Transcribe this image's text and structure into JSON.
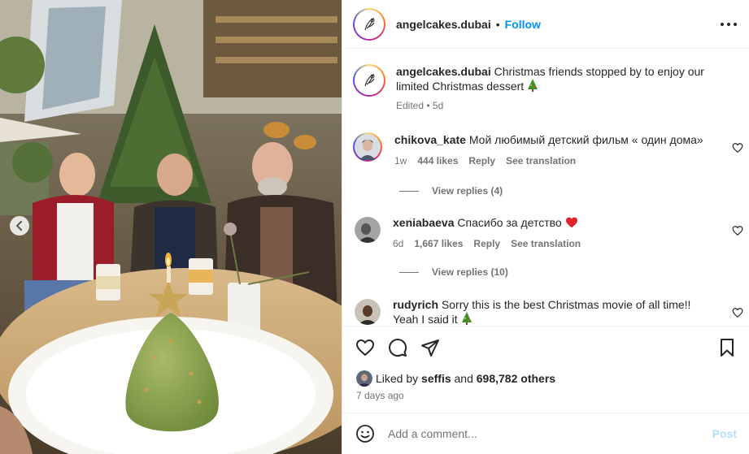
{
  "post": {
    "username": "angelcakes.dubai",
    "follow_label": "Follow",
    "separator": "•",
    "more_icon": "more-horizontal-icon"
  },
  "caption": {
    "username": "angelcakes.dubai",
    "text": "Christmas friends stopped by to enjoy our limited Christmas dessert",
    "emoji": "christmas-tree-icon",
    "edited": "Edited",
    "dot": "•",
    "age": "5d"
  },
  "comments": [
    {
      "username": "chikova_kate",
      "text": "Мой любимый детский фильм « один дома»",
      "age": "1w",
      "likes": "444 likes",
      "reply": "Reply",
      "translate": "See translation",
      "replies": "View replies (4)"
    },
    {
      "username": "xeniabaeva",
      "text": "Спасибо за детство",
      "emoji": "red-heart-icon",
      "age": "6d",
      "likes": "1,667 likes",
      "reply": "Reply",
      "translate": "See translation",
      "replies": "View replies (10)"
    },
    {
      "username": "rudyrich",
      "text": "Sorry this is the best Christmas movie of all time!! Yeah I said it",
      "emoji": "christmas-tree-icon"
    }
  ],
  "likes": {
    "prefix": "Liked by",
    "user": "seffis",
    "joiner": "and",
    "others": "698,782 others"
  },
  "date": "7 days ago",
  "composer": {
    "placeholder": "Add a comment...",
    "post_label": "Post"
  },
  "carousel": {
    "count": 6,
    "active_index": 5
  },
  "colors": {
    "accent": "#0095f6",
    "post_disabled": "#b2dffc",
    "muted": "#737373",
    "like_heart": "#ed4956"
  }
}
